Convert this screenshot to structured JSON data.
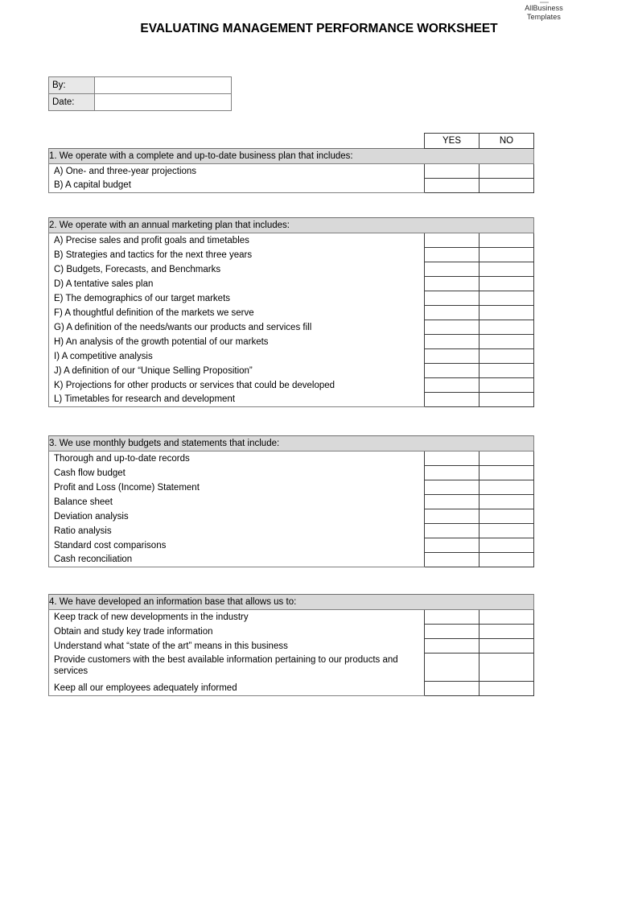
{
  "brand": {
    "line1": "AllBusiness",
    "line2": "Templates"
  },
  "document": {
    "title": "EVALUATING MANAGEMENT PERFORMANCE WORKSHEET"
  },
  "meta": {
    "by_label": "By:",
    "by_value": "",
    "date_label": "Date:",
    "date_value": ""
  },
  "columns": {
    "yes": "YES",
    "no": "NO"
  },
  "colors": {
    "section_header_bg": "#d9d9d9",
    "meta_label_bg": "#e8e8e8",
    "border": "#3a3a3a",
    "outer_border": "#7f7f7f"
  },
  "sections": [
    {
      "header": "1. We operate with a complete and up-to-date business plan that includes:",
      "items": [
        "A) One- and three-year projections",
        "B) A capital budget"
      ]
    },
    {
      "header": "2.  We operate with an annual marketing plan that includes:",
      "items": [
        "A) Precise sales and profit goals and timetables",
        "B) Strategies and tactics for the next three years",
        "C) Budgets, Forecasts, and Benchmarks",
        "D) A tentative sales plan",
        "E) The demographics of our target markets",
        "F) A thoughtful definition of the markets we serve",
        "G) A definition of the needs/wants our products and services fill",
        "H) An analysis of the growth potential of our markets",
        "I) A competitive analysis",
        "J) A definition of our “Unique Selling Proposition”",
        "K) Projections for other products or services that could be developed",
        "L) Timetables for research and development"
      ]
    },
    {
      "header": "3.  We use monthly budgets and statements that include:",
      "items": [
        "Thorough and up-to-date records",
        "Cash flow budget",
        "Profit and Loss (Income) Statement",
        "Balance sheet",
        "Deviation analysis",
        "Ratio analysis",
        "Standard cost comparisons",
        "Cash reconciliation"
      ]
    },
    {
      "header": "4.  We have developed an information base that allows us to:",
      "items": [
        "Keep track of new developments in the industry",
        "Obtain and study key trade information",
        "Understand what “state of the art” means in this business",
        "Provide customers with the best available information pertaining to our products and services",
        "Keep all our employees adequately informed"
      ]
    }
  ]
}
